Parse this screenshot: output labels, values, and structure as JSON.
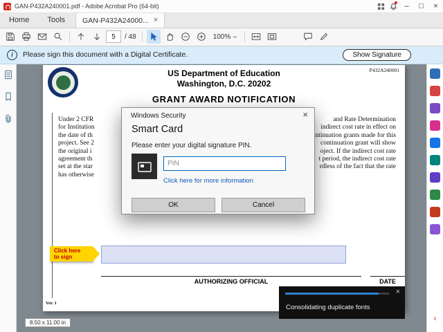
{
  "titlebar": {
    "title": "GAN-P432A240001.pdf - Adobe Acrobat Pro (64-bit)"
  },
  "tabbar": {
    "home": "Home",
    "tools": "Tools",
    "doc_tab": "GAN-P432A24000...",
    "close_glyph": "×"
  },
  "toolbar": {
    "page_current": "5",
    "page_total": "/ 48",
    "zoom_level": "100%"
  },
  "banner": {
    "message": "Please sign this document with a Digital Certificate.",
    "action": "Show Signature"
  },
  "document": {
    "code": "P432A240001",
    "title_line1": "US Department of Education",
    "title_line2": "Washington, D.C. 20202",
    "heading": "GRANT AWARD NOTIFICATION",
    "paragraph_lines": [
      {
        "left": "Under 2 CFR",
        "right": "and Rate Determination"
      },
      {
        "left": "for Institution",
        "right": "indirect cost rate in effect on"
      },
      {
        "left": "the date of th",
        "right": "ntinuation grants made for this"
      },
      {
        "left": "project. See 2",
        "right": "continuation grant will show"
      },
      {
        "left": "the original i",
        "right": "oject. If the indirect cost rate"
      },
      {
        "left": "agreement th",
        "right": "t period, the indirect cost rate"
      },
      {
        "left": "set at the star",
        "right": "rdless of the fact that the rate"
      },
      {
        "left": "has otherwise",
        "right": ""
      }
    ],
    "sign_callout_line1": "Click here",
    "sign_callout_line2": "to sign",
    "authorizing_label": "AUTHORIZING OFFICIAL",
    "date_label": "DATE",
    "version": "Ver. 1",
    "page_size_chip": "8.50 x 11.00 in"
  },
  "dialog": {
    "title": "Windows Security",
    "close_glyph": "×",
    "heading": "Smart Card",
    "prompt": "Please enter your digital signature PIN.",
    "pin_placeholder": "PIN",
    "link": "Click here for more information",
    "ok_label": "OK",
    "cancel_label": "Cancel"
  },
  "toast": {
    "message": "Consolidating duplicate fonts",
    "close_glyph": "×",
    "progress_width": "90%"
  },
  "icons": {
    "window": {
      "minimize": "–",
      "maximize": "□",
      "close": "×"
    },
    "info": "i",
    "collapse_panel": "‹"
  },
  "colors": {
    "banner_bg": "#d9ecf9",
    "callout_yellow": "#ffd400",
    "callout_text": "#c00000",
    "signature_field_bg": "#dbe0f5",
    "toast_progress": "#2f7fd6",
    "rail_tools": [
      "#2c6fb7",
      "#d64541",
      "#7b4bc4",
      "#d6308f",
      "#1473e6",
      "#00857c",
      "#5f3dc4",
      "#2d8a46",
      "#c33a1f",
      "#8a56d6"
    ]
  }
}
